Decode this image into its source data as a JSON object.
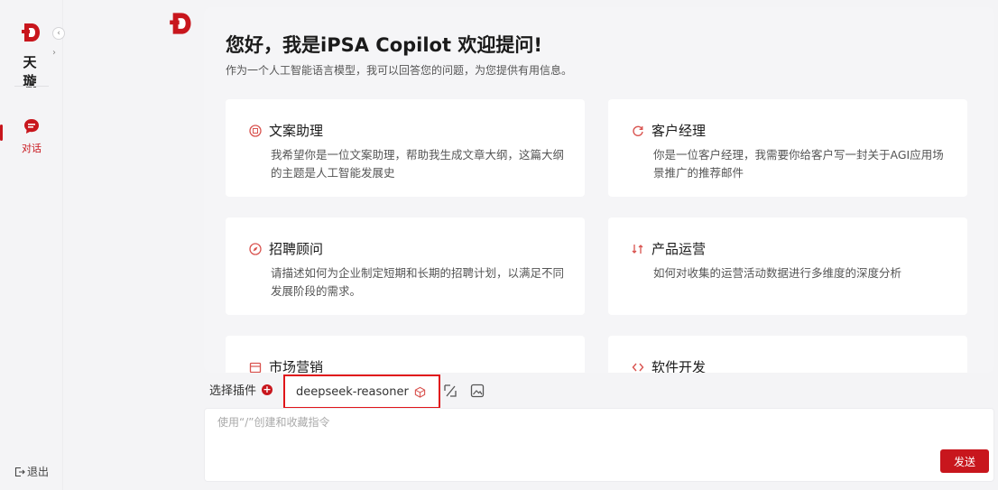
{
  "sidebar": {
    "brand_name": "天 璇",
    "nav": [
      {
        "label": "对话"
      }
    ],
    "logout_label": "退出"
  },
  "main": {
    "greeting": "您好，我是iPSA Copilot 欢迎提问!",
    "sub_greeting": "作为一个人工智能语言模型，我可以回答您的问题，为您提供有用信息。",
    "cards": [
      {
        "icon": "doc-edit-icon",
        "title": "文案助理",
        "desc": "我希望你是一位文案助理，帮助我生成文章大纲，这篇大纲的主题是人工智能发展史"
      },
      {
        "icon": "refresh-icon",
        "title": "客户经理",
        "desc": "你是一位客户经理，我需要你给客户写一封关于AGI应用场景推广的推荐邮件"
      },
      {
        "icon": "compass-icon",
        "title": "招聘顾问",
        "desc": "请描述如何为企业制定短期和长期的招聘计划，以满足不同发展阶段的需求。"
      },
      {
        "icon": "swap-icon",
        "title": "产品运营",
        "desc": "如何对收集的运营活动数据进行多维度的深度分析"
      },
      {
        "icon": "calendar-icon",
        "title": "市场营销",
        "desc": ""
      },
      {
        "icon": "code-icon",
        "title": "软件开发",
        "desc": ""
      }
    ]
  },
  "composer": {
    "plugin_label": "选择插件",
    "model_name": "deepseek-reasoner",
    "input_placeholder": "使用“/”创建和收藏指令",
    "send_label": "发送"
  },
  "colors": {
    "accent": "#c8161d",
    "highlight_border": "#e0151a"
  }
}
